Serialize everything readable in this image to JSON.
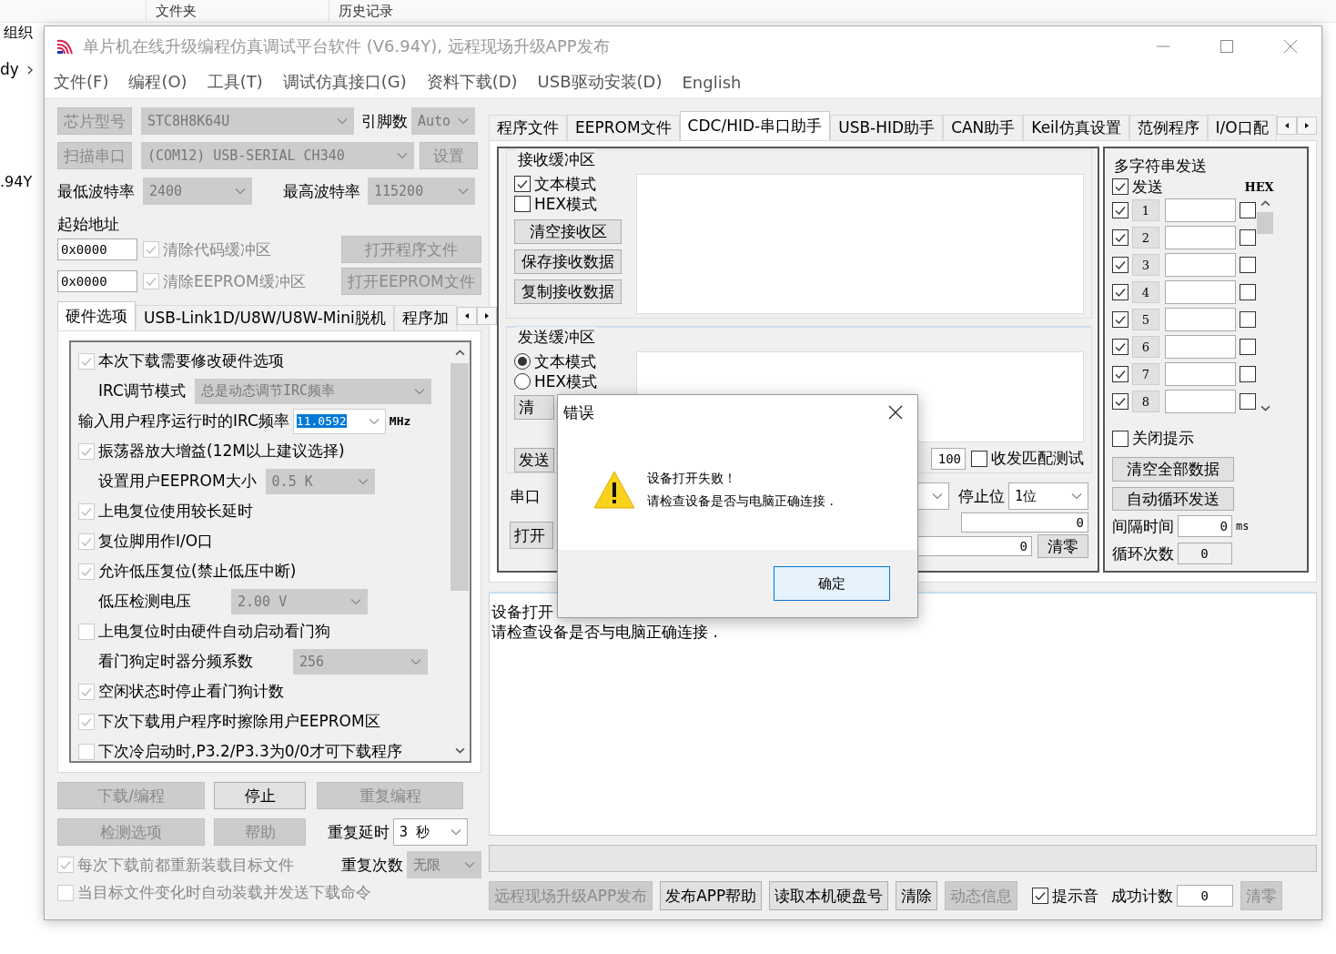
{
  "desktop": {
    "top_items": [
      "文件夹",
      "历史记录"
    ],
    "toolbar_label": "组织",
    "path_fragment": "dy",
    "list_fragment": ".94Y"
  },
  "window": {
    "title": "单片机在线升级编程仿真调试平台软件 (V6.94Y), 远程现场升级APP发布",
    "menu": [
      "文件(F)",
      "编程(O)",
      "工具(T)",
      "调试仿真接口(G)",
      "资料下载(D)",
      "USB驱动安装(D)",
      "English"
    ]
  },
  "left": {
    "chip_button": {
      "label": "芯片型号",
      "disabled": true
    },
    "chip_select": {
      "value": "STC8H8K64U",
      "disabled": true
    },
    "pins_label": "引脚数",
    "pins_select": {
      "value": "Auto",
      "disabled": true
    },
    "scan_button": {
      "label": "扫描串口",
      "disabled": true
    },
    "port_select": {
      "value": "(COM12) USB-SERIAL CH340",
      "disabled": true
    },
    "settings_button": {
      "label": "设置",
      "disabled": true
    },
    "min_baud_label": "最低波特率",
    "min_baud_select": {
      "value": "2400",
      "disabled": true
    },
    "max_baud_label": "最高波特率",
    "max_baud_select": {
      "value": "115200",
      "disabled": true
    },
    "address_label": "起始地址",
    "address_rows": [
      {
        "address": "0x0000",
        "checkbox": {
          "label": "清除代码缓冲区",
          "checked": true
        },
        "button": {
          "label": "打开程序文件",
          "disabled": true
        }
      },
      {
        "address": "0x0000",
        "checkbox": {
          "label": "清除EEPROM缓冲区",
          "checked": true
        },
        "button": {
          "label": "打开EEPROM文件",
          "disabled": true
        }
      }
    ],
    "tabs": [
      {
        "label": "硬件选项",
        "selected": true
      },
      {
        "label": "USB-Link1D/U8W/U8W-Mini脱机",
        "selected": false
      },
      {
        "label": "程序加",
        "selected": false
      }
    ],
    "options": [
      {
        "kind": "checkbox",
        "label": "本次下载需要修改硬件选项",
        "checked": true
      },
      {
        "kind": "select",
        "label": "IRC调节模式",
        "value": "总是动态调节IRC频率"
      },
      {
        "kind": "input",
        "label": "输入用户程序运行时的IRC频率",
        "value": "11.0592",
        "unit": "MHz",
        "value_selected": true
      },
      {
        "kind": "checkbox",
        "label": "振荡器放大增益(12M以上建议选择)",
        "checked": true
      },
      {
        "kind": "select",
        "label": "设置用户EEPROM大小",
        "value": "0.5 K"
      },
      {
        "kind": "checkbox",
        "label": "上电复位使用较长延时",
        "checked": true
      },
      {
        "kind": "checkbox",
        "label": "复位脚用作I/O口",
        "checked": true
      },
      {
        "kind": "checkbox",
        "label": "允许低压复位(禁止低压中断)",
        "checked": true
      },
      {
        "kind": "select",
        "label": "低压检测电压",
        "value": "2.00 V"
      },
      {
        "kind": "checkbox",
        "label": "上电复位时由硬件自动启动看门狗",
        "checked": false
      },
      {
        "kind": "select",
        "label": "看门狗定时器分频系数",
        "value": "256"
      },
      {
        "kind": "checkbox",
        "label": "空闲状态时停止看门狗计数",
        "checked": true
      },
      {
        "kind": "checkbox",
        "label": "下次下载用户程序时擦除用户EEPROM区",
        "checked": true
      },
      {
        "kind": "checkbox",
        "label": "下次冷启动时,P3.2/P3.3为0/0才可下载程序",
        "checked": false
      }
    ],
    "action_buttons": [
      {
        "label": "下载/编程",
        "disabled": true
      },
      {
        "label": "停止",
        "disabled": false
      },
      {
        "label": "重复编程",
        "disabled": true
      },
      {
        "label": "检测选项",
        "disabled": true
      },
      {
        "label": "帮助",
        "disabled": true
      }
    ],
    "repeat_delay": {
      "label": "重复延时",
      "value": "3 秒",
      "disabled": false
    },
    "repeat_count": {
      "label": "重复次数",
      "value": "无限",
      "disabled": true
    },
    "reload_checks": [
      {
        "label": "每次下载前都重新装载目标文件",
        "checked": true
      },
      {
        "label": "当目标文件变化时自动装载并发送下载命令",
        "checked": false
      }
    ]
  },
  "right": {
    "tabs": [
      {
        "label": "程序文件",
        "selected": false
      },
      {
        "label": "EEPROM文件",
        "selected": false
      },
      {
        "label": "CDC/HID-串口助手",
        "selected": true
      },
      {
        "label": "USB-HID助手",
        "selected": false
      },
      {
        "label": "CAN助手",
        "selected": false
      },
      {
        "label": "Keil仿真设置",
        "selected": false
      },
      {
        "label": "范例程序",
        "selected": false
      },
      {
        "label": "I/O口配",
        "selected": false
      }
    ],
    "receive": {
      "title": "接收缓冲区",
      "modes": [
        {
          "label": "文本模式",
          "checked": true
        },
        {
          "label": "HEX模式",
          "checked": false
        }
      ],
      "buttons": [
        "清空接收区",
        "保存接收数据",
        "复制接收数据"
      ]
    },
    "send": {
      "title": "发送缓冲区",
      "modes": [
        {
          "label": "文本模式",
          "selected": true
        },
        {
          "label": "HEX模式",
          "selected": false
        }
      ],
      "clear_button": "清",
      "send_button": "发送",
      "interval": "100",
      "match_test": {
        "label": "收发匹配测试",
        "checked": false
      }
    },
    "port_row": {
      "label": "串口",
      "stop_bits_label": "停止位",
      "stop_bits": "1位"
    },
    "open_row": {
      "open_button": "打开",
      "rx_count": "0",
      "tx_count": "0",
      "reset_button": "清零"
    },
    "multi": {
      "title": "多字符串发送",
      "send_all": {
        "label": "发送",
        "checked": true
      },
      "hex_header": "HEX",
      "rows": [
        {
          "number": "1",
          "checked": true,
          "hex": false
        },
        {
          "number": "2",
          "checked": true,
          "hex": false
        },
        {
          "number": "3",
          "checked": true,
          "hex": false
        },
        {
          "number": "4",
          "checked": true,
          "hex": false
        },
        {
          "number": "5",
          "checked": true,
          "hex": false
        },
        {
          "number": "6",
          "checked": true,
          "hex": false
        },
        {
          "number": "7",
          "checked": true,
          "hex": false
        },
        {
          "number": "8",
          "checked": true,
          "hex": false
        }
      ],
      "close_tips": {
        "label": "关闭提示",
        "checked": false
      },
      "buttons": [
        "清空全部数据",
        "自动循环发送"
      ],
      "interval_label": "间隔时间",
      "interval": "0",
      "interval_unit": "ms",
      "loop_label": "循环次数",
      "loop_count": "0"
    },
    "log": [
      "设备打开",
      "请检查设备是否与电脑正确连接 ."
    ],
    "bottom_buttons": [
      {
        "label": "远程现场升级APP发布",
        "disabled": true
      },
      {
        "label": "发布APP帮助",
        "disabled": false
      },
      {
        "label": "读取本机硬盘号",
        "disabled": false
      },
      {
        "label": "清除",
        "disabled": false
      },
      {
        "label": "动态信息",
        "disabled": true
      }
    ],
    "sound": {
      "label": "提示音",
      "checked": true
    },
    "success_label": "成功计数",
    "success_count": "0",
    "success_reset": {
      "label": "清零",
      "disabled": true
    }
  },
  "dialog": {
    "title": "错误",
    "lines": [
      "设备打开失败！",
      "请检查设备是否与电脑正确连接 ."
    ],
    "ok_button": "确定"
  }
}
